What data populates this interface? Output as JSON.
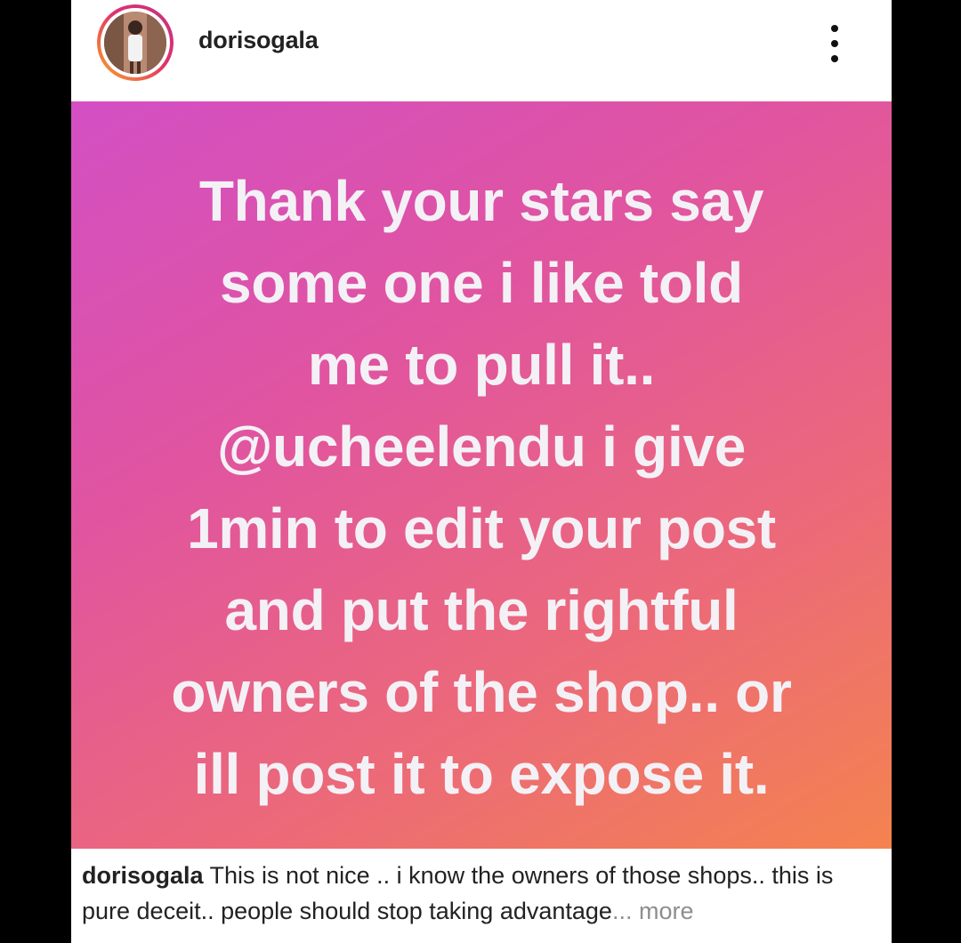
{
  "post": {
    "username": "dorisogala",
    "avatar_icon": "profile-photo",
    "menu_icon": "more-vertical-icon",
    "image_lines": [
      "Thank your stars say",
      "some one i like told",
      "me to pull it..",
      "@ucheelendu i give",
      "1min to edit your post",
      "and put the rightful",
      "owners of the shop.. or",
      "ill post it to expose it."
    ],
    "caption": {
      "username": "dorisogala",
      "text": " This is not nice .. i know the owners of those shops.. this is pure deceit.. people should stop taking advantage",
      "ellipsis": "...",
      "more_label": " more"
    }
  },
  "colors": {
    "gradient_start": "#d34fc4",
    "gradient_end": "#f4834f",
    "background": "#000000",
    "muted_text": "#8e8e8e"
  }
}
